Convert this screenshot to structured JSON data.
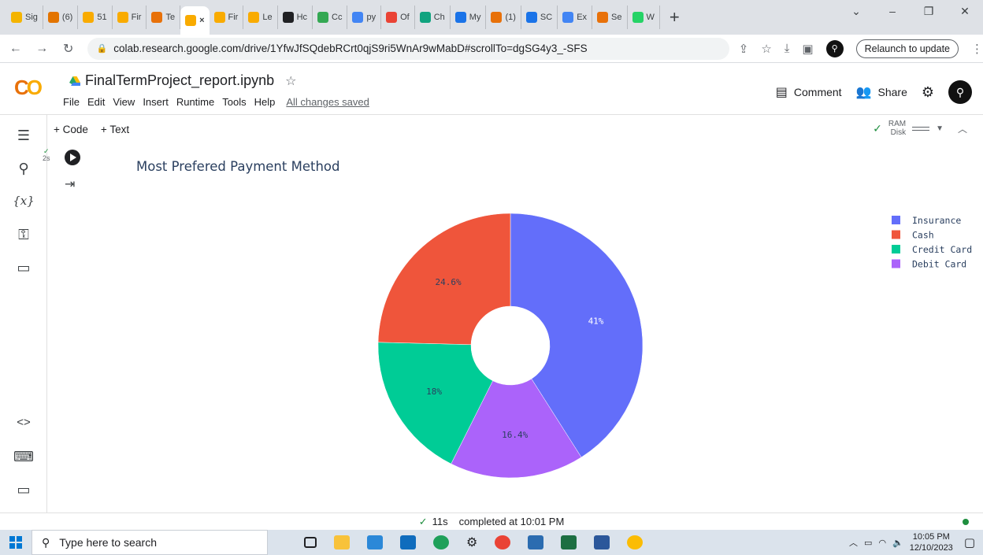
{
  "browser": {
    "tabs": [
      {
        "label": "Sig",
        "color": "#f4b400"
      },
      {
        "label": "(6)",
        "color": "#e37400"
      },
      {
        "label": "51",
        "color": "#f9ab00"
      },
      {
        "label": "Fir",
        "color": "#f9ab00"
      },
      {
        "label": "Te",
        "color": "#e8710a"
      },
      {
        "label": "×",
        "color": "#f9ab00"
      },
      {
        "label": "Fir",
        "color": "#f9ab00"
      },
      {
        "label": "Le",
        "color": "#f9ab00"
      },
      {
        "label": "Hc",
        "color": "#202124"
      },
      {
        "label": "Cc",
        "color": "#34a853"
      },
      {
        "label": "py",
        "color": "#4285f4"
      },
      {
        "label": "Of",
        "color": "#ea4335"
      },
      {
        "label": "Ch",
        "color": "#10a37f"
      },
      {
        "label": "My",
        "color": "#1a73e8"
      },
      {
        "label": "(1)",
        "color": "#e8710a"
      },
      {
        "label": "SC",
        "color": "#1a73e8"
      },
      {
        "label": "Ex",
        "color": "#4285f4"
      },
      {
        "label": "Se",
        "color": "#e8710a"
      },
      {
        "label": "W",
        "color": "#25d366"
      }
    ],
    "url": "colab.research.google.com/drive/1YfwJfSQdebRCrt0qjS9ri5WnAr9wMabD#scrollTo=dgSG4y3_-SFS",
    "relaunch_label": "Relaunch to update"
  },
  "colab": {
    "title": "FinalTermProject_report.ipynb",
    "menu": [
      "File",
      "Edit",
      "View",
      "Insert",
      "Runtime",
      "Tools",
      "Help"
    ],
    "saved_status": "All changes saved",
    "comment_label": "Comment",
    "share_label": "Share",
    "add_code_label": "+ Code",
    "add_text_label": "+ Text",
    "ram_label": "RAM",
    "disk_label": "Disk",
    "cell_exec_time": "2s",
    "status_time": "11s",
    "status_text": "completed at 10:01 PM"
  },
  "chart_data": {
    "type": "pie",
    "title": "Most Prefered Payment Method",
    "hole": true,
    "slices": [
      {
        "label": "Insurance",
        "value": 41,
        "display": "41%",
        "color": "#636efa"
      },
      {
        "label": "Debit Card",
        "value": 16.4,
        "display": "16.4%",
        "color": "#ab63fa"
      },
      {
        "label": "Credit Card",
        "value": 18,
        "display": "18%",
        "color": "#00cc96"
      },
      {
        "label": "Cash",
        "value": 24.6,
        "display": "24.6%",
        "color": "#ef553b"
      }
    ],
    "legend": [
      "Insurance",
      "Cash",
      "Credit Card",
      "Debit Card"
    ],
    "legend_position": "top-right"
  },
  "taskbar": {
    "search_placeholder": "Type here to search",
    "time": "10:05 PM",
    "date": "12/10/2023"
  }
}
